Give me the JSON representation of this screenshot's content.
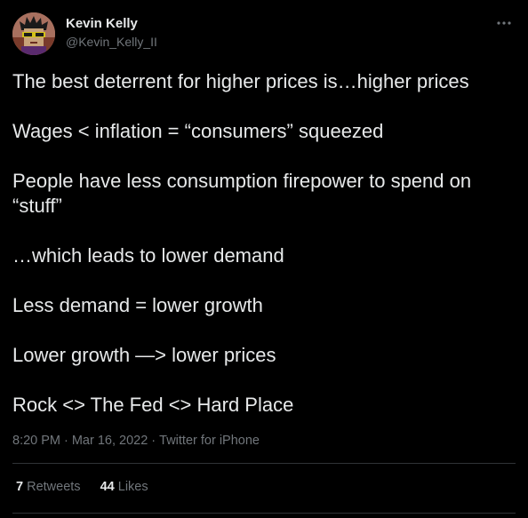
{
  "author": {
    "display_name": "Kevin Kelly",
    "handle": "@Kevin_Kelly_II"
  },
  "more_icon": "ellipsis-icon",
  "paragraphs": [
    "The best deterrent for higher prices is…higher prices",
    "Wages < inflation = “consumers” squeezed",
    "People have less consumption firepower to spend on “stuff”",
    "…which leads to lower demand",
    "Less demand = lower growth",
    "Lower growth —> lower prices",
    "Rock <> The Fed <> Hard Place"
  ],
  "meta": {
    "time": "8:20 PM",
    "separator": "·",
    "date": "Mar 16, 2022",
    "source": "Twitter for iPhone"
  },
  "stats": {
    "retweets_count": "7",
    "retweets_label": "Retweets",
    "likes_count": "44",
    "likes_label": "Likes"
  },
  "colors": {
    "background": "#000000",
    "text": "#e7e9ea",
    "muted": "#71767b",
    "divider": "#2f3336"
  }
}
